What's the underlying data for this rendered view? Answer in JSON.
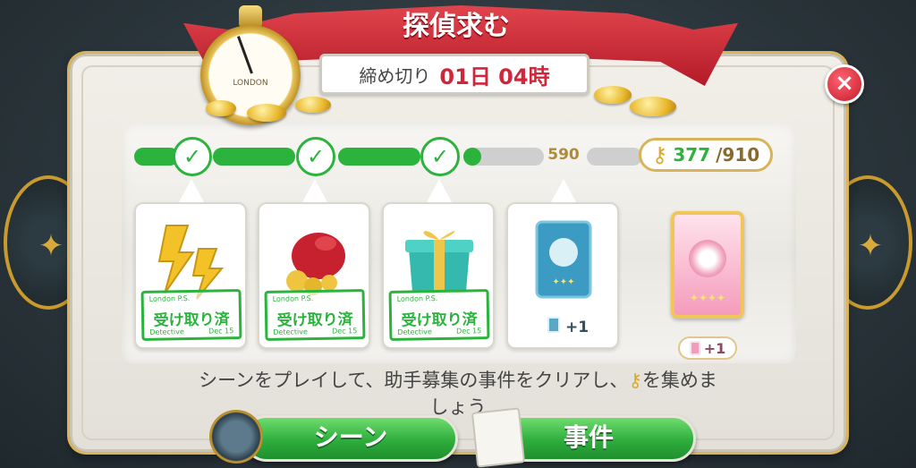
{
  "title": "探偵求む",
  "deadline": {
    "label": "締め切り",
    "value": "01日 04時"
  },
  "stopwatch": {
    "face_text": "LONDON"
  },
  "close_button": {
    "label": "×"
  },
  "progress": {
    "milestones_completed": 3,
    "current_milestone_value": "590",
    "keys_current": "377",
    "keys_total": "/910"
  },
  "rewards": [
    {
      "type": "energy",
      "status": "受け取り済",
      "claimed": true
    },
    {
      "type": "coin-pouch",
      "status": "受け取り済",
      "claimed": true
    },
    {
      "type": "gift-box",
      "status": "受け取り済",
      "claimed": true
    },
    {
      "type": "blue-card-pack",
      "quantity": "+1",
      "claimed": false
    }
  ],
  "stamp_text": {
    "top": "London P.S.",
    "foot_left": "Detective",
    "foot_right": "Dec 15"
  },
  "final_reward": {
    "type": "pink-card-pack",
    "quantity": "+1"
  },
  "instruction": {
    "part1": "シーンをプレイして、助手募集の事件をクリアし、",
    "part2": "を集めま",
    "part3": "しょう"
  },
  "buttons": {
    "scene": "シーン",
    "case": "事件"
  },
  "colors": {
    "accent_green": "#2cb33e",
    "ribbon_red": "#c8202f",
    "gold": "#d8b35a",
    "deadline_red": "#d1263a"
  }
}
